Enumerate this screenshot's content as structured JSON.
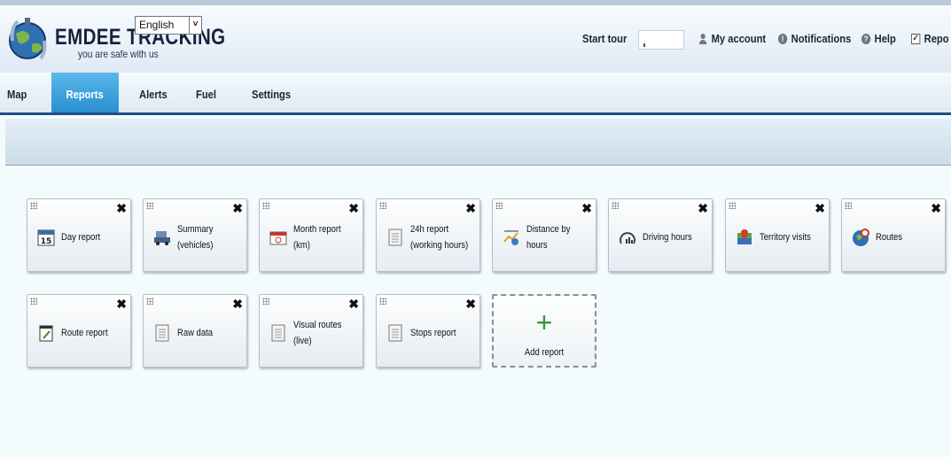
{
  "header": {
    "brand": "EMDEE TRACKING",
    "tagline": "you are safe with us",
    "language_selected": "English",
    "links": {
      "start_tour": "Start tour",
      "my_account": "My account",
      "notifications": "Notifications",
      "help": "Help",
      "reports": "Repo"
    }
  },
  "nav": {
    "tabs": [
      "Map",
      "Reports",
      "Alerts",
      "Fuel",
      "Settings"
    ],
    "active_tab": "Reports"
  },
  "reports": {
    "cards": [
      {
        "label": "Day report",
        "icon": "calendar-icon"
      },
      {
        "label": "Summary\n(vehicles)",
        "icon": "vehicle-icon"
      },
      {
        "label": "Month report (km)",
        "icon": "month-calendar-icon"
      },
      {
        "label": "24h report\n(working hours)",
        "icon": "document-icon"
      },
      {
        "label": "Distance by hours",
        "icon": "distance-chart-icon"
      },
      {
        "label": "Driving hours",
        "icon": "gauge-icon"
      },
      {
        "label": "Territory visits",
        "icon": "map-pin-icon"
      },
      {
        "label": "Routes",
        "icon": "globe-icon"
      },
      {
        "label": "Route report",
        "icon": "notepad-icon"
      },
      {
        "label": "Raw data",
        "icon": "document-icon"
      },
      {
        "label": "Visual routes (live)",
        "icon": "document-icon"
      },
      {
        "label": "Stops report",
        "icon": "document-icon"
      }
    ],
    "add_label": "Add report",
    "add_symbol": "+"
  },
  "colors": {
    "active_tab": "#2a8fd0",
    "nav_border": "#1f4f86",
    "add_plus": "#2e9a2e"
  }
}
